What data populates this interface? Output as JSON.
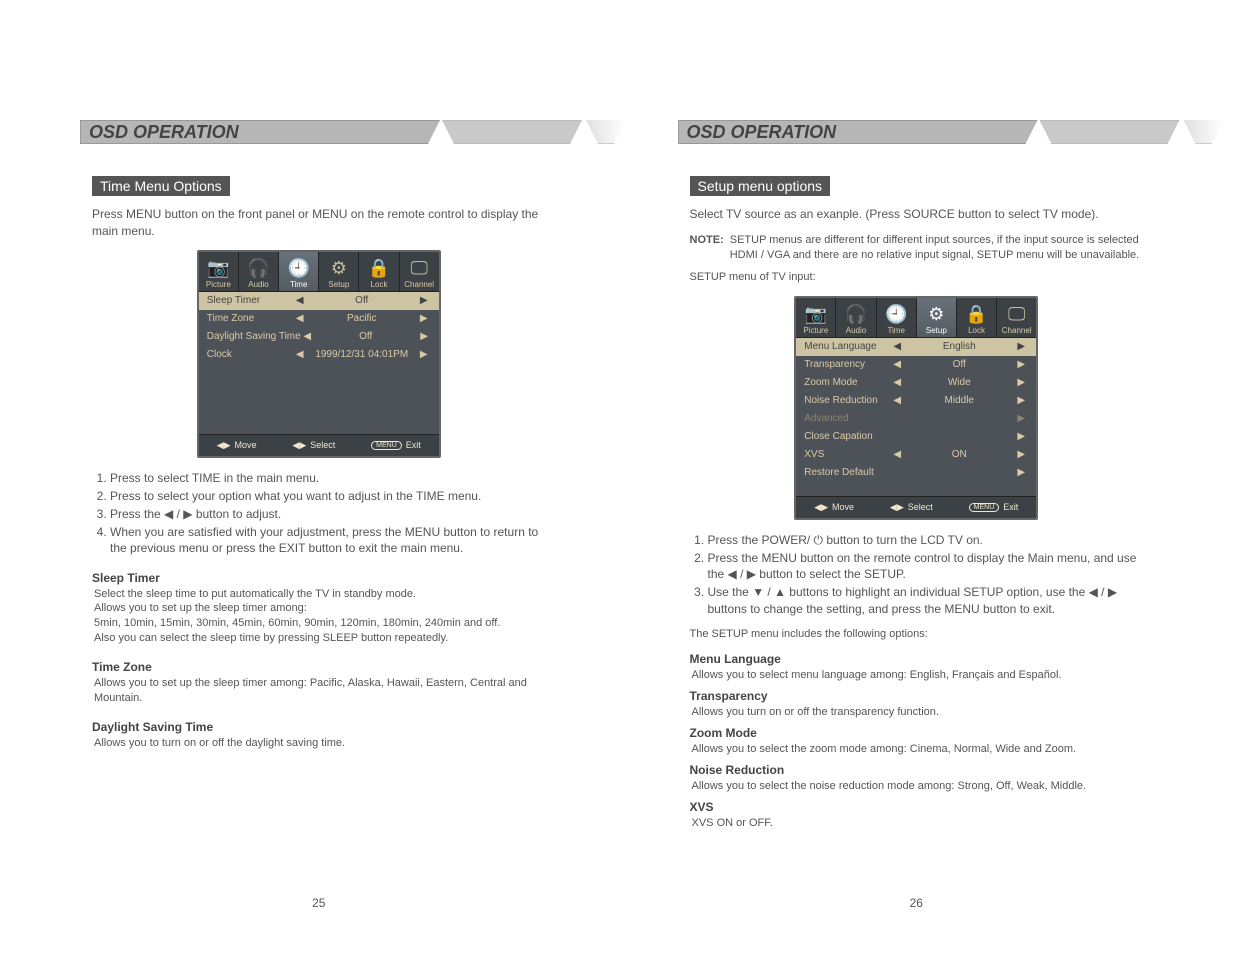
{
  "left": {
    "banner": "OSD OPERATION",
    "subheading": "Time Menu Options",
    "intro": "Press MENU button on the front panel or MENU on the remote control to display the main menu.",
    "tabs": [
      {
        "label": "Picture",
        "icon": "📷"
      },
      {
        "label": "Audio",
        "icon": "🎧"
      },
      {
        "label": "Time",
        "icon": "🕘",
        "active": true
      },
      {
        "label": "Setup",
        "icon": "⚙"
      },
      {
        "label": "Lock",
        "icon": "🔒"
      },
      {
        "label": "Channel",
        "icon": "🖵"
      }
    ],
    "rows": [
      {
        "label": "Sleep Timer",
        "value": "Off",
        "selected": true
      },
      {
        "label": "Time Zone",
        "value": "Pacific"
      },
      {
        "label": "Daylight Saving Time",
        "value": "Off"
      },
      {
        "label": "Clock",
        "value": "1999/12/31 04:01PM"
      }
    ],
    "footer": {
      "move": "Move",
      "select": "Select",
      "exit": "Exit",
      "exit_badge": "MENU"
    },
    "steps": [
      "Press to select TIME in the main menu.",
      "Press to select your option what you want to adjust in the TIME menu.",
      "Press the ◀ / ▶ button to adjust.",
      "When you are satisfied with your adjustment, press the MENU button to return to the previous menu or press the EXIT button to exit the main menu."
    ],
    "sections": [
      {
        "title": "Sleep Timer",
        "body": "Select the sleep time to put automatically the TV in standby mode.\nAllows you to set up the sleep timer among:\n5min, 10min, 15min, 30min, 45min, 60min, 90min, 120min, 180min, 240min and off.\nAlso you can select the sleep time by pressing SLEEP button repeatedly."
      },
      {
        "title": "Time Zone",
        "body": "Allows you to set up the sleep timer among: Pacific, Alaska, Hawaii, Eastern, Central and Mountain."
      },
      {
        "title": "Daylight Saving Time",
        "body": "Allows you to turn on or off the daylight saving time."
      }
    ],
    "pagenum": "25"
  },
  "right": {
    "banner": "OSD OPERATION",
    "subheading": "Setup menu options",
    "intro": "Select TV source as an exanple. (Press SOURCE button to select TV mode).",
    "note_label": "NOTE:",
    "note_body": "SETUP menus are different for different input sources, if the input source is selected HDMI / VGA and there are no relative input signal, SETUP menu will be unavailable.",
    "list_label": "SETUP menu of TV input:",
    "tabs": [
      {
        "label": "Picture",
        "icon": "📷"
      },
      {
        "label": "Audio",
        "icon": "🎧"
      },
      {
        "label": "Time",
        "icon": "🕘"
      },
      {
        "label": "Setup",
        "icon": "⚙",
        "active": true
      },
      {
        "label": "Lock",
        "icon": "🔒"
      },
      {
        "label": "Channel",
        "icon": "🖵"
      }
    ],
    "rows": [
      {
        "label": "Menu Language",
        "value": "English",
        "selected": true
      },
      {
        "label": "Transparency",
        "value": "Off"
      },
      {
        "label": "Zoom Mode",
        "value": "Wide"
      },
      {
        "label": "Noise Reduction",
        "value": "Middle"
      },
      {
        "label": "Advanced",
        "value": "",
        "dim": true,
        "no_left": true
      },
      {
        "label": "Close Capation",
        "value": "",
        "no_left": true
      },
      {
        "label": "XVS",
        "value": "ON"
      },
      {
        "label": "Restore Default",
        "value": "",
        "no_left": true
      }
    ],
    "footer": {
      "move": "Move",
      "select": "Select",
      "exit": "Exit",
      "exit_badge": "MENU"
    },
    "steps": [
      "Press the POWER/ ⏻ button to turn the LCD TV on.",
      "Press the MENU button on the remote control to display the Main menu, and use the ◀ / ▶ button to select the SETUP.",
      "Use the ▼ / ▲ buttons to highlight an individual SETUP option, use the ◀ / ▶ buttons to change the setting, and press the MENU button to exit."
    ],
    "options_intro": "The SETUP menu includes the following options:",
    "sections": [
      {
        "title": "Menu Language",
        "body": "Allows you to select menu language among: English, Français and Español."
      },
      {
        "title": "Transparency",
        "body": "Allows you turn on or off the transparency function."
      },
      {
        "title": "Zoom Mode",
        "body": "Allows you to select the zoom mode among: Cinema, Normal, Wide and Zoom."
      },
      {
        "title": "Noise Reduction",
        "body": "Allows you to select the noise reduction mode among: Strong, Off, Weak, Middle."
      },
      {
        "title": "XVS",
        "body": "XVS ON or OFF."
      }
    ],
    "pagenum": "26"
  }
}
